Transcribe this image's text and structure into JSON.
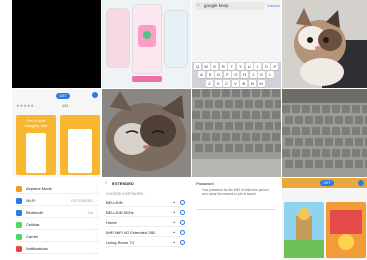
{
  "tile_search": {
    "query": "google keep",
    "placeholder": "",
    "cancel_label": "Cancel"
  },
  "keyboard": {
    "row1": [
      "Q",
      "W",
      "E",
      "R",
      "T",
      "Y",
      "U",
      "I",
      "O",
      "P"
    ],
    "row2": [
      "A",
      "S",
      "D",
      "F",
      "G",
      "H",
      "J",
      "K",
      "L"
    ],
    "row3": [
      "Z",
      "X",
      "C",
      "V",
      "B",
      "N",
      "M"
    ]
  },
  "app_store": {
    "rating_count": "161",
    "get_label": "GET",
    "promo_text": "Get to your thoughts, fast"
  },
  "settings": {
    "rows": [
      {
        "label": "Airplane Mode",
        "value": "",
        "color": "#f29c1f"
      },
      {
        "label": "Wi-Fi",
        "value": "EXTENDED",
        "color": "#2a7be4"
      },
      {
        "label": "Bluetooth",
        "value": "On",
        "color": "#2a7be4"
      },
      {
        "label": "Cellular",
        "value": "",
        "color": "#4cd964"
      },
      {
        "label": "Carrier",
        "value": "",
        "color": "#4cd964"
      },
      {
        "label": "Notifications",
        "value": "",
        "color": "#e8453c"
      }
    ]
  },
  "wifi": {
    "header": "EXTENDED",
    "section_label": "CHOOSE A NETWORK...",
    "networks": [
      "BELLKIN",
      "BELLKIN 5GHz",
      "Home",
      "WiFi MiFi 4G Extended 280",
      "Living Room TV"
    ]
  },
  "password": {
    "title": "Password",
    "text": "Your password for the WiFi in which the person who owns the network to join is saved"
  },
  "app_store2": {
    "get_label": "GET"
  }
}
